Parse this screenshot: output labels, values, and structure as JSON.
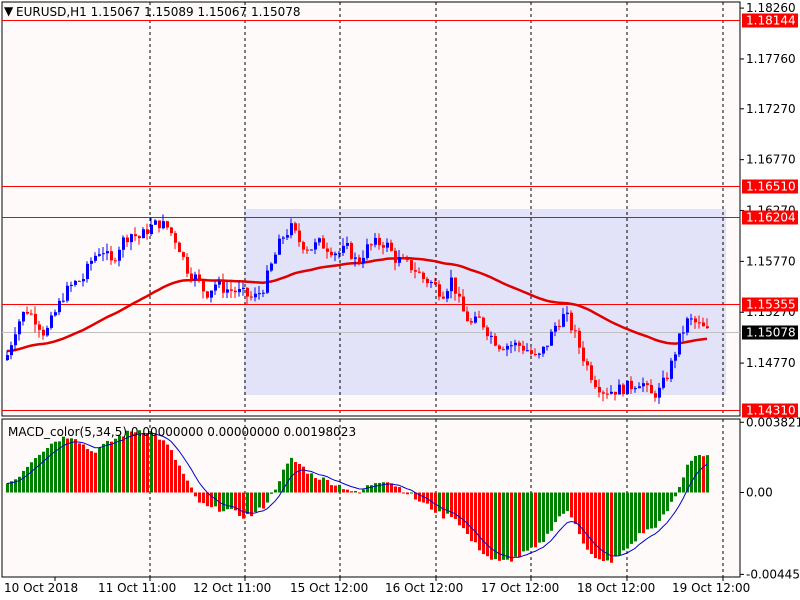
{
  "header": {
    "symbol_label": "EURUSD,H1  1.15067 1.15089 1.15067 1.15078"
  },
  "indicator": {
    "label": "MACD_color(5,34,5) 0.00000000 0.00000000 0.00198023"
  },
  "colors": {
    "background": "#ffffff",
    "plot_background": "#fffafa",
    "rectangle_fill": "#e2e2f8",
    "level_line": "#ff0000",
    "ma_line": "#e00000",
    "bull_candle": "#0000ff",
    "bear_candle": "#ff0000",
    "macd_up": "#008000",
    "macd_down": "#ff0000",
    "signal_line": "#0000cc",
    "grid": "#000000",
    "price_tag_bg": "#ff0000",
    "current_tag_bg": "#000000"
  },
  "price_axis": {
    "ticks": [
      "1.18260",
      "1.17760",
      "1.17270",
      "1.16770",
      "1.16270",
      "1.15770",
      "1.15270",
      "1.14770"
    ],
    "levels": [
      {
        "label": "1.18144",
        "price": 1.18144
      },
      {
        "label": "1.16510",
        "price": 1.1651
      },
      {
        "label": "1.16204",
        "price": 1.16204
      },
      {
        "label": "1.15355",
        "price": 1.15355
      },
      {
        "label": "1.14310",
        "price": 1.1431
      }
    ],
    "current": {
      "label": "1.15078",
      "price": 1.15078
    },
    "ylim": [
      1.1425,
      1.1832
    ]
  },
  "macd_axis": {
    "ticks": [
      "0.0038217",
      "0.00",
      "-0.004457"
    ],
    "ylim": [
      -0.0046,
      0.004
    ]
  },
  "time_axis": {
    "labels": [
      "10 Oct 2018",
      "11 Oct 11:00",
      "12 Oct 11:00",
      "15 Oct 12:00",
      "16 Oct 12:00",
      "17 Oct 12:00",
      "18 Oct 12:00",
      "19 Oct 12:00"
    ]
  },
  "chart_data": {
    "type": "candlestick",
    "symbol": "EURUSD",
    "timeframe": "H1",
    "close_path": [
      1.1485,
      1.1515,
      1.153,
      1.152,
      1.1505,
      1.1525,
      1.1545,
      1.1555,
      1.156,
      1.158,
      1.159,
      1.1575,
      1.1595,
      1.1605,
      1.16,
      1.161,
      1.1615,
      1.161,
      1.1595,
      1.157,
      1.156,
      1.1545,
      1.1555,
      1.155,
      1.1548,
      1.1545,
      1.154,
      1.155,
      1.1575,
      1.16,
      1.161,
      1.1595,
      1.159,
      1.1595,
      1.159,
      1.1585,
      1.159,
      1.1575,
      1.159,
      1.1595,
      1.1595,
      1.158,
      1.1575,
      1.157,
      1.156,
      1.1555,
      1.1545,
      1.156,
      1.153,
      1.1515,
      1.152,
      1.1505,
      1.1495,
      1.1495,
      1.1495,
      1.149,
      1.148,
      1.1495,
      1.1515,
      1.1525,
      1.1505,
      1.148,
      1.146,
      1.145,
      1.145,
      1.1452,
      1.1455,
      1.146,
      1.1445,
      1.145,
      1.147,
      1.15,
      1.152,
      1.1515,
      1.1508
    ],
    "macd_histogram": [
      0.0005,
      0.0008,
      0.0014,
      0.002,
      0.0024,
      0.0028,
      0.003,
      0.0031,
      0.0026,
      0.0022,
      0.0025,
      0.0028,
      0.0031,
      0.0033,
      0.0034,
      0.0033,
      0.003,
      0.0025,
      0.0016,
      0.0006,
      -0.0004,
      -0.0008,
      -0.0009,
      -0.0009,
      -0.0011,
      -0.0013,
      -0.0012,
      -0.0008,
      -0.0001,
      0.001,
      0.0018,
      0.0015,
      0.001,
      0.0008,
      0.0006,
      0.0004,
      0.0002,
      -0.0001,
      0.0003,
      0.0006,
      0.0007,
      0.0004,
      0.0001,
      -0.0003,
      -0.0006,
      -0.0009,
      -0.0013,
      -0.0012,
      -0.0018,
      -0.0026,
      -0.0031,
      -0.0036,
      -0.0038,
      -0.0037,
      -0.0035,
      -0.0032,
      -0.003,
      -0.0024,
      -0.0015,
      -0.001,
      -0.0016,
      -0.0028,
      -0.0036,
      -0.0038,
      -0.0037,
      -0.0033,
      -0.0028,
      -0.0022,
      -0.002,
      -0.0016,
      -0.0008,
      0.0002,
      0.0017,
      0.0021,
      0.0019
    ]
  }
}
